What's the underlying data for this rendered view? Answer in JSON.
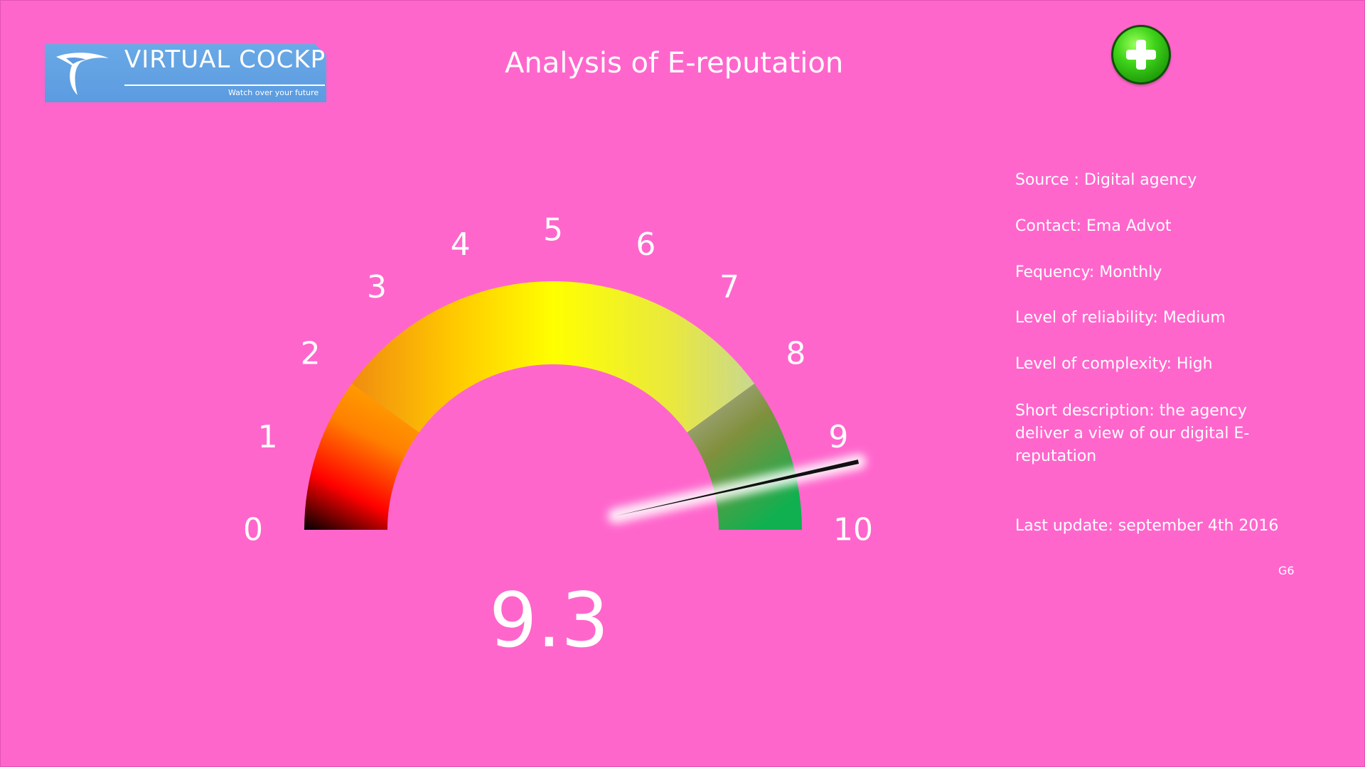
{
  "logo": {
    "brand": "VIRTUAL COCKPIT",
    "tagline": "Watch over your future"
  },
  "header": {
    "title": "Analysis of E-reputation",
    "add_button_icon": "plus-circle-icon"
  },
  "gauge": {
    "min": 0,
    "max": 10,
    "value": 9.3,
    "value_label": "9.3",
    "tick_labels": [
      "0",
      "1",
      "2",
      "3",
      "4",
      "5",
      "6",
      "7",
      "8",
      "9",
      "10"
    ],
    "zones": [
      {
        "from": 0,
        "to": 2,
        "colors": [
          "#000000",
          "#ff0000",
          "#ff8c00"
        ]
      },
      {
        "from": 2,
        "to": 8,
        "colors": [
          "#f0a000",
          "#ffff00",
          "#d8e080"
        ]
      },
      {
        "from": 8,
        "to": 10,
        "colors": [
          "#9aa080",
          "#7a9040",
          "#10b050"
        ]
      }
    ]
  },
  "info": {
    "source": "Source : Digital agency",
    "contact": "Contact: Ema Advot",
    "frequency": "Fequency: Monthly",
    "reliability": "Level of reliability: Medium",
    "complexity": "Level of complexity:  High",
    "description": "Short description: the agency deliver a view of our digital E-reputation",
    "last_update": "Last update:  september 4th 2016",
    "code": "G6"
  },
  "colors": {
    "background": "#ff66cc",
    "text": "#ffffff",
    "logo_bg": "#5b9be0",
    "add_button": "#2db814"
  }
}
